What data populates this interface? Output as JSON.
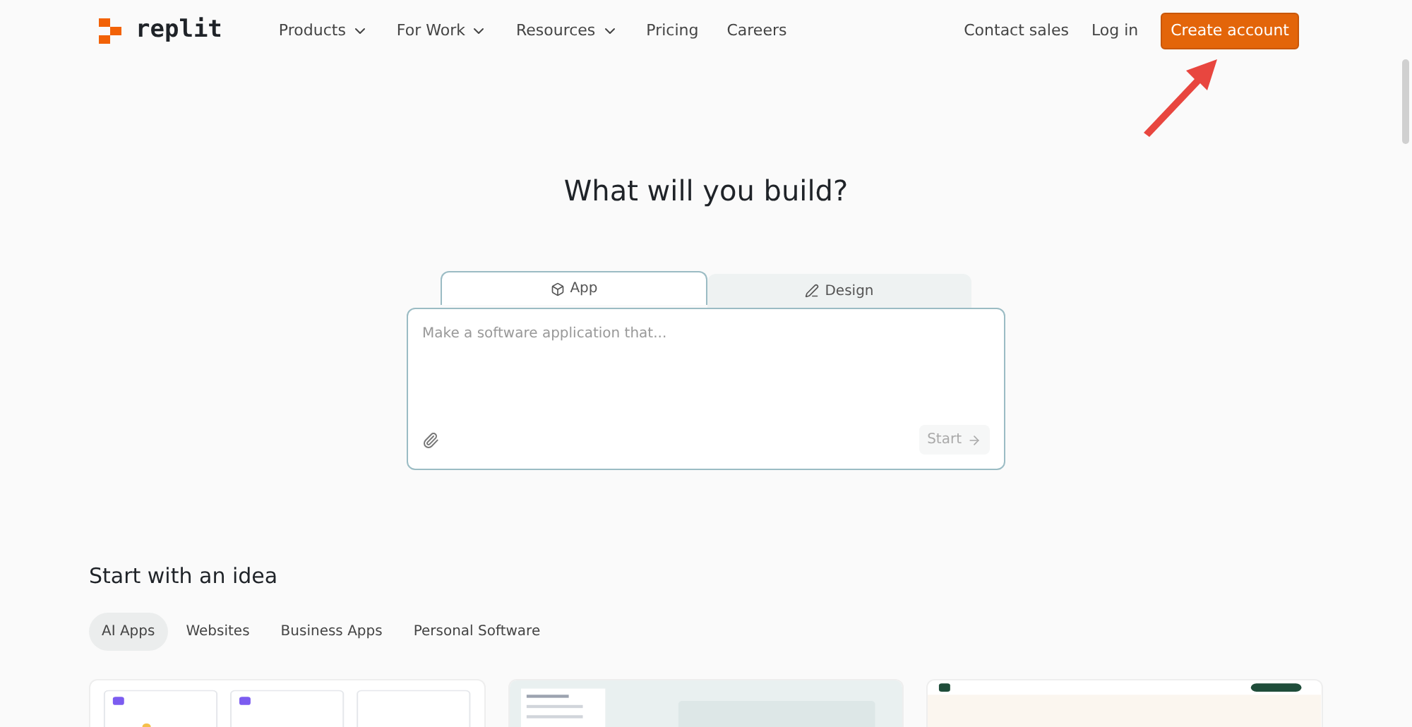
{
  "nav": {
    "logo": "replit",
    "menu": [
      {
        "label": "Products",
        "dropdown": true
      },
      {
        "label": "For Work",
        "dropdown": true
      },
      {
        "label": "Resources",
        "dropdown": true
      },
      {
        "label": "Pricing",
        "dropdown": false
      },
      {
        "label": "Careers",
        "dropdown": false
      }
    ],
    "contact": "Contact sales",
    "login": "Log in",
    "signup": "Create account"
  },
  "heading": "What will you build?",
  "modes": [
    {
      "label": "App",
      "selected": true
    },
    {
      "label": "Design",
      "selected": false
    }
  ],
  "prompt": {
    "placeholder": "Make a software application that...",
    "submit": "Start"
  },
  "ideas": {
    "title": "Start with an idea",
    "filters": [
      {
        "label": "AI Apps",
        "selected": true
      },
      {
        "label": "Websites",
        "selected": false
      },
      {
        "label": "Business Apps",
        "selected": false
      },
      {
        "label": "Personal Software",
        "selected": false
      }
    ]
  }
}
